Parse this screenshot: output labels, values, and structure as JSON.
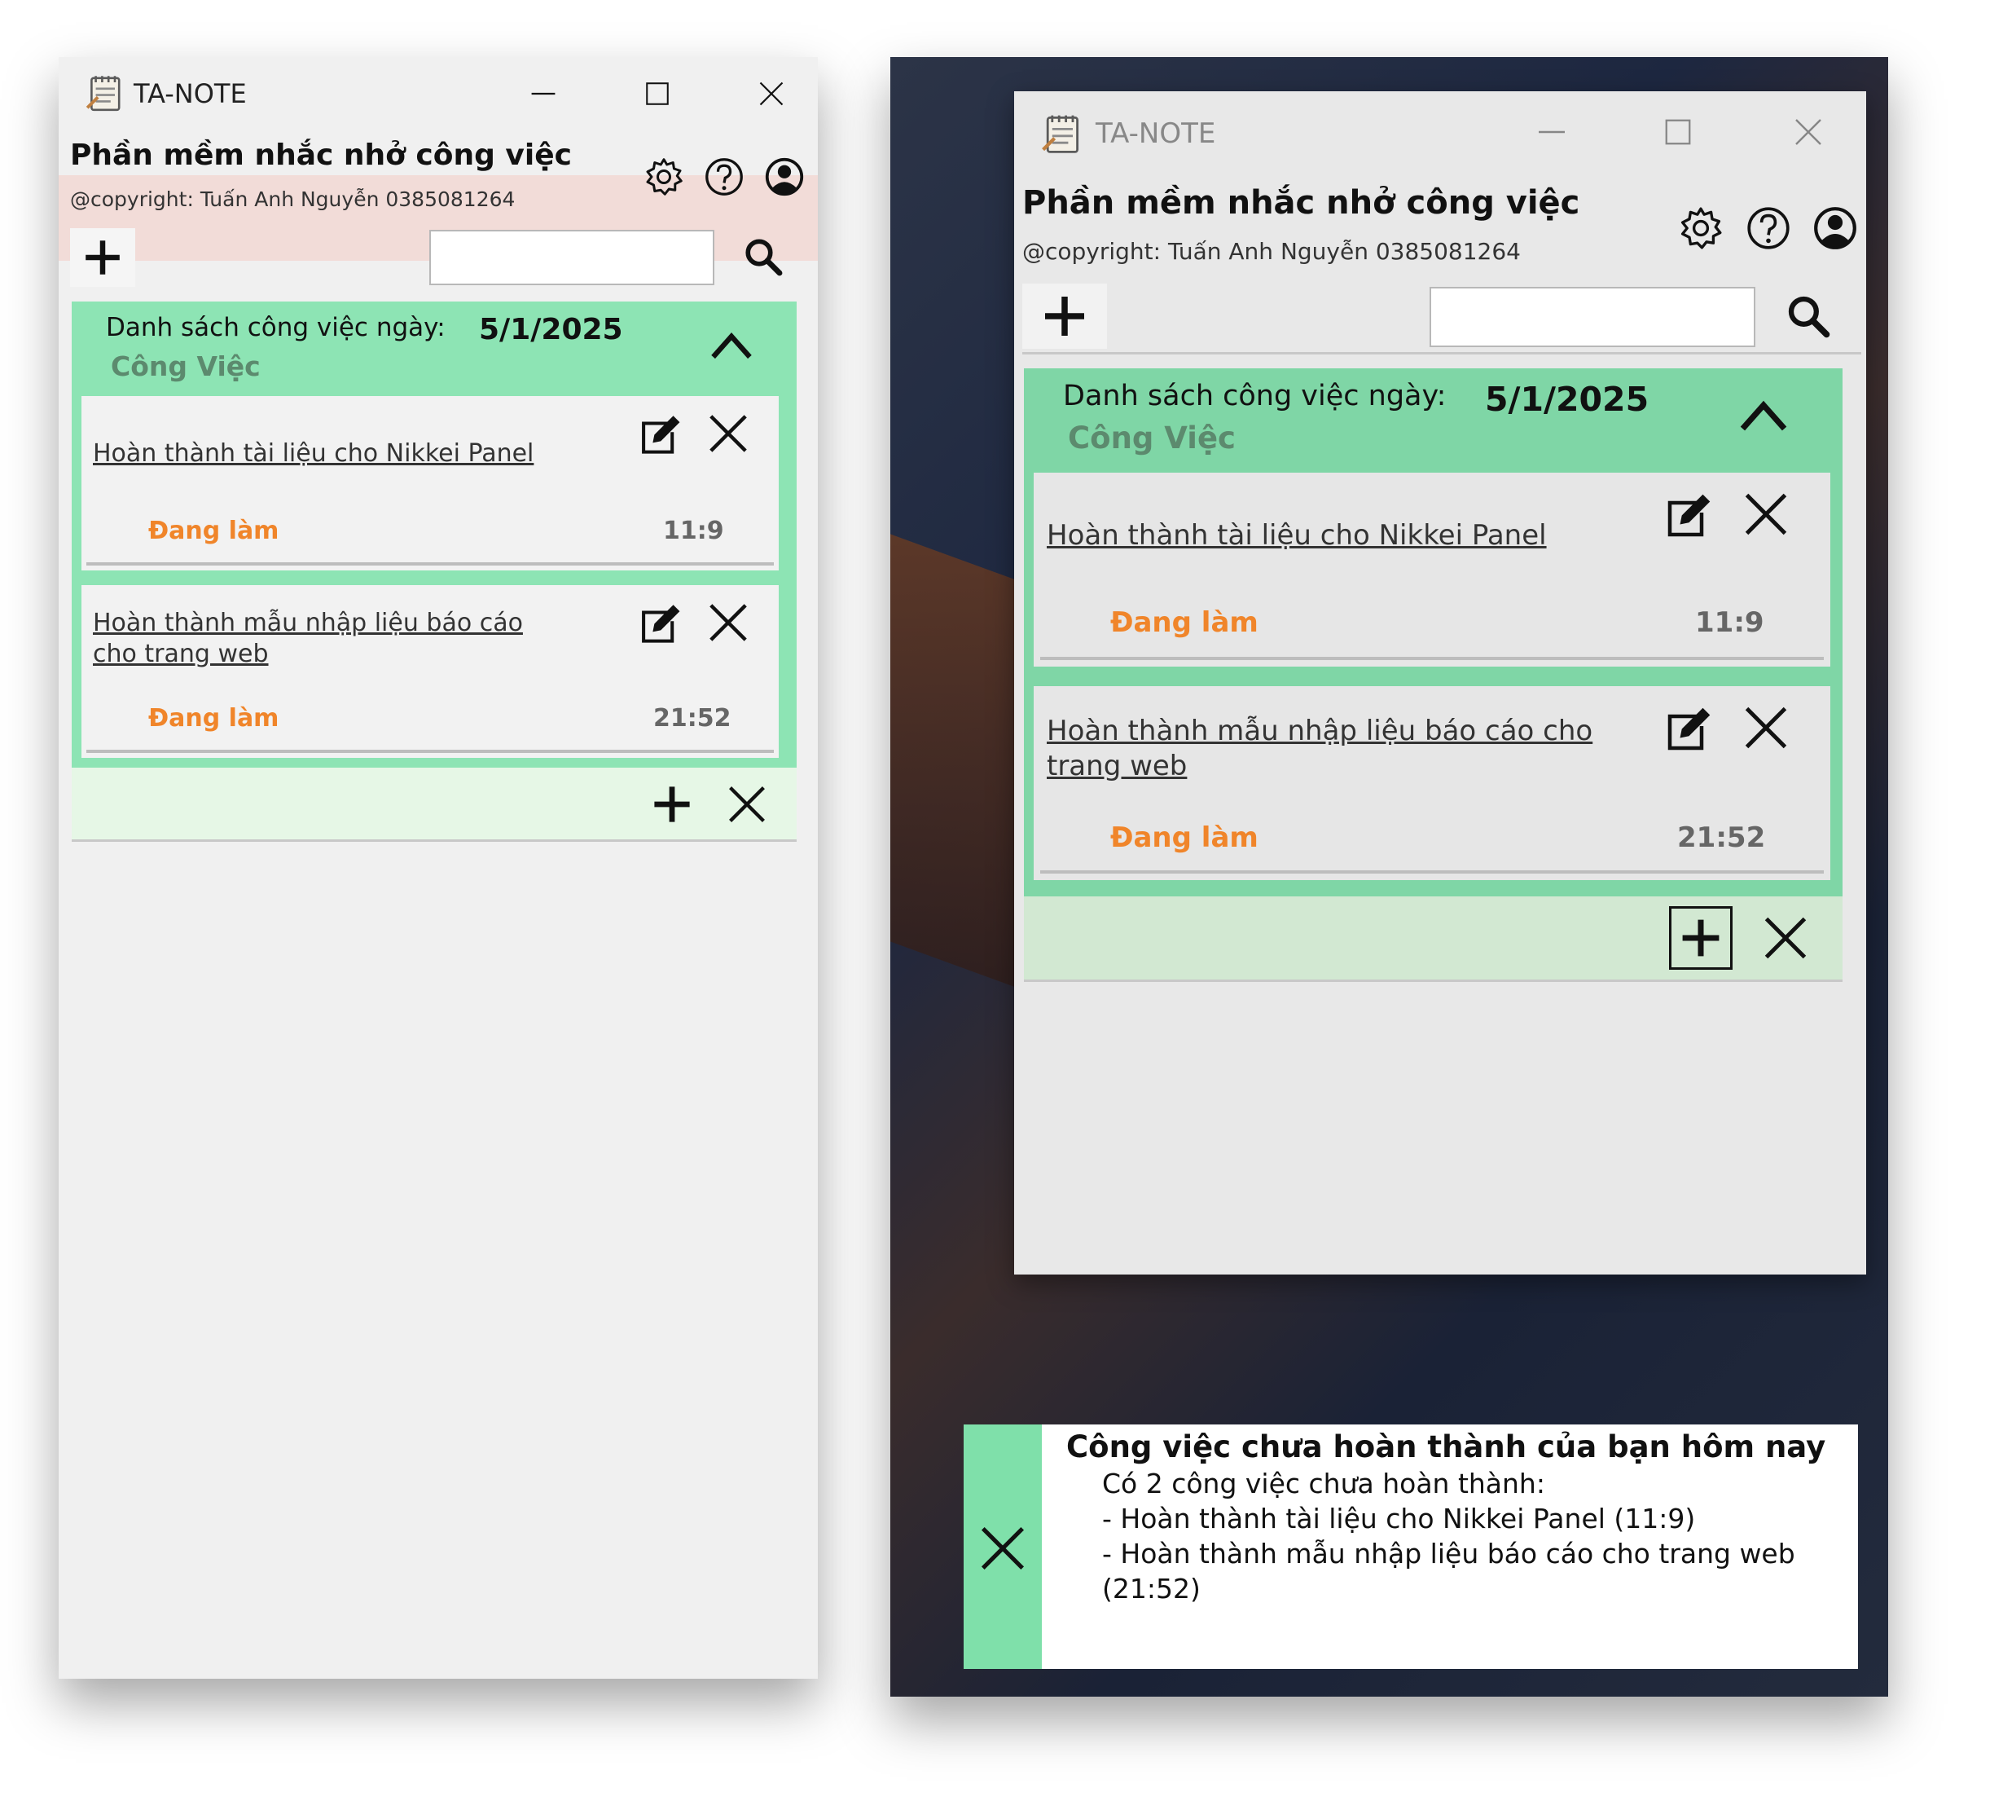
{
  "app": {
    "title": "TA-NOTE",
    "heading": "Phần mềm nhắc nhở công việc",
    "copyright": "@copyright: Tuấn Anh Nguyễn 0385081264"
  },
  "search": {
    "value": "",
    "placeholder": ""
  },
  "list": {
    "label": "Danh sách công việc ngày:",
    "date": "5/1/2025",
    "category": "Công Việc"
  },
  "tasks": [
    {
      "title": "Hoàn thành tài liệu cho Nikkei Panel",
      "status": "Đang làm",
      "time": "11:9"
    },
    {
      "title": "Hoàn thành mẫu nhập liệu báo cáo cho trang web",
      "status": "Đang làm",
      "time": "21:52"
    }
  ],
  "notification": {
    "title": "Công việc chưa hoàn thành của bạn hôm nay",
    "summary": "Có 2 công việc chưa hoàn thành:",
    "items": [
      "- Hoàn thành tài liệu cho Nikkei Panel (11:9)",
      "- Hoàn thành mẫu nhập liệu báo cáo cho trang web (21:52)"
    ]
  },
  "icons": {
    "app": "notepad-icon",
    "minimize": "minimize-icon",
    "maximize": "maximize-icon",
    "close": "close-icon",
    "settings": "gear-icon",
    "help": "help-icon",
    "account": "user-icon",
    "add": "plus-icon",
    "search": "search-icon",
    "collapse": "chevron-up-icon",
    "edit": "edit-icon",
    "delete": "close-icon"
  },
  "colors": {
    "accent_green": "#8de4b4",
    "status_orange": "#f0852a",
    "window_bg": "#f0f0f0",
    "footer_bg": "#e6f7e6"
  }
}
